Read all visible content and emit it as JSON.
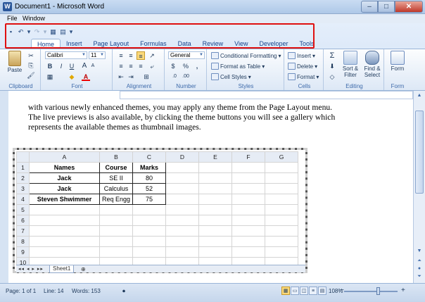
{
  "window": {
    "title": "Document1 - Microsoft Word",
    "icon": "word-icon",
    "minimize": "–",
    "maximize": "□",
    "close": "✕"
  },
  "menu": {
    "file": "File",
    "window": "Window"
  },
  "qat": {
    "items": [
      "save-icon",
      "undo-icon",
      "undo-dropdown",
      "redo-icon",
      "redo-dropdown",
      "table-icon",
      "chart-icon",
      "customize-dropdown"
    ],
    "glyphs": [
      "▪",
      "↶",
      "▾",
      "↷",
      "▾",
      "▦",
      "▤",
      "▾"
    ]
  },
  "tabs": [
    "Home",
    "Insert",
    "Page Layout",
    "Formulas",
    "Data",
    "Review",
    "View",
    "Developer",
    "Tools"
  ],
  "ribbon": {
    "clipboard": {
      "label": "Clipboard",
      "paste": "Paste",
      "cut": "✂",
      "copy": "⎘",
      "painter": "🖌"
    },
    "font": {
      "label": "Font",
      "name": "Calibri",
      "size": "11",
      "grow": "A",
      "shrink": "A",
      "bold": "B",
      "italic": "I",
      "underline": "U",
      "border": "▦",
      "fill": "◆",
      "color": "A"
    },
    "alignment": {
      "label": "Alignment"
    },
    "number": {
      "label": "Number",
      "format": "General",
      "currency": "$",
      "percent": "%",
      "comma": ","
    },
    "styles": {
      "label": "Styles",
      "conditional": "Conditional Formatting",
      "table": "Format as Table",
      "cell": "Cell Styles"
    },
    "cells": {
      "label": "Cells",
      "insert": "Insert",
      "delete": "Delete",
      "format": "Format"
    },
    "editing": {
      "label": "Editing",
      "sum": "Σ",
      "sort": "Sort &",
      "sort2": "Filter",
      "find": "Find &",
      "find2": "Select"
    },
    "form": {
      "label": "Form",
      "btn": "Form"
    }
  },
  "document": {
    "lines": [
      "with various newly enhanced themes, you may apply any theme from the Page Layout menu.",
      "The live previews is also available, by clicking the theme buttons you will see a gallery which",
      "represents the available themes as thumbnail images."
    ]
  },
  "sheet": {
    "columns": [
      "A",
      "B",
      "C",
      "D",
      "E",
      "F",
      "G"
    ],
    "rows": [
      {
        "n": "1",
        "a": "Names",
        "b": "Course",
        "c": "Marks"
      },
      {
        "n": "2",
        "a": "Jack",
        "b": "SE II",
        "c": "80"
      },
      {
        "n": "3",
        "a": "Jack",
        "b": "Calculus",
        "c": "52"
      },
      {
        "n": "4",
        "a": "Steven Shwimmer",
        "b": "Req Engg",
        "c": "75"
      },
      {
        "n": "5"
      },
      {
        "n": "6"
      },
      {
        "n": "7"
      },
      {
        "n": "8"
      },
      {
        "n": "9"
      },
      {
        "n": "10"
      }
    ],
    "tab": "Sheet1",
    "nav": "◂◂ ◂ ▸ ▸▸"
  },
  "status": {
    "page": "Page: 1 of 1",
    "line": "Line: 14",
    "words": "Words: 153",
    "zoom": "108%",
    "zoom_level_percent": 108,
    "minus": "−",
    "plus": "+"
  }
}
